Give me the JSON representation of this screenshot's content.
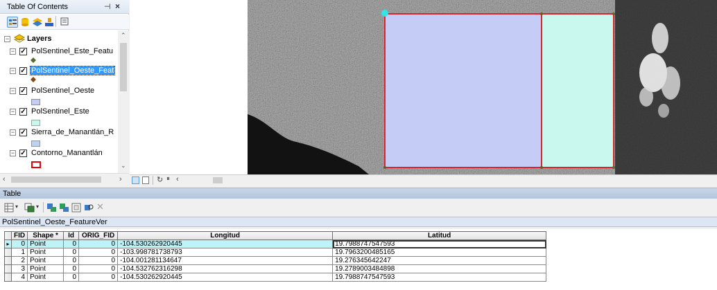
{
  "toc": {
    "title": "Table Of Contents",
    "pin_glyph": "ᵖ",
    "close_glyph": "×",
    "root_label": "Layers",
    "layers": [
      {
        "label": "PolSentinel_Este_Featu",
        "symbol": "point",
        "color": "#556b2f",
        "selected": false
      },
      {
        "label": "PolSentinel_Oeste_Feat",
        "symbol": "point",
        "color": "#8b4513",
        "selected": true
      },
      {
        "label": "PolSentinel_Oeste",
        "symbol": "fill",
        "color": "#c5cdf2",
        "selected": false
      },
      {
        "label": "PolSentinel_Este",
        "symbol": "fill",
        "color": "#c8f7ec",
        "selected": false
      },
      {
        "label": "Sierra_de_Manantlán_R",
        "symbol": "fill",
        "color": "#bcd2ee",
        "selected": false
      },
      {
        "label": "Contorno_Manantlán",
        "symbol": "outline",
        "color": "#e8000b",
        "selected": false
      }
    ]
  },
  "map": {
    "west_polygon_color": "#c5cdf6",
    "east_polygon_color": "#c8f8ee",
    "outline_color": "#d9262d",
    "vertex_color": "#33e3e8"
  },
  "table_window": {
    "title": "Table",
    "sheet_name": "PolSentinel_Oeste_FeatureVer",
    "columns": [
      "FID",
      "Shape *",
      "Id",
      "ORIG_FID",
      "Longitud",
      "Latitud"
    ],
    "rows": [
      {
        "fid": "0",
        "shape": "Point",
        "id": "0",
        "orig_fid": "0",
        "lon": "-104.530262920445",
        "lat": "19.7988747547593"
      },
      {
        "fid": "1",
        "shape": "Point",
        "id": "0",
        "orig_fid": "0",
        "lon": "-103.998781738793",
        "lat": "19.7963200485165"
      },
      {
        "fid": "2",
        "shape": "Point",
        "id": "0",
        "orig_fid": "0",
        "lon": "-104.001281134647",
        "lat": "19.276345642247"
      },
      {
        "fid": "3",
        "shape": "Point",
        "id": "0",
        "orig_fid": "0",
        "lon": "-104.532762316298",
        "lat": "19.2789003484898"
      },
      {
        "fid": "4",
        "shape": "Point",
        "id": "0",
        "orig_fid": "0",
        "lon": "-104.530262920445",
        "lat": "19.7988747547593"
      }
    ],
    "current_row_marker": "▸"
  }
}
